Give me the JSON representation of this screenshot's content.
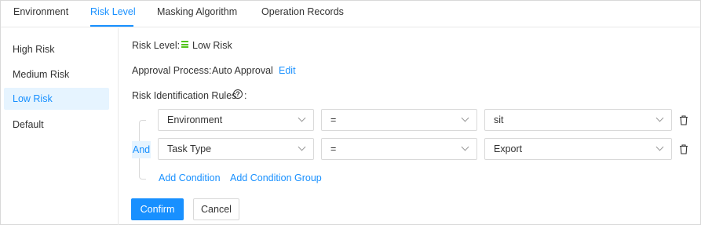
{
  "tabs": [
    {
      "label": "Environment",
      "active": false
    },
    {
      "label": "Risk Level",
      "active": true
    },
    {
      "label": "Masking Algorithm",
      "active": false
    },
    {
      "label": "Operation Records",
      "active": false
    }
  ],
  "sidebar": {
    "items": [
      {
        "label": "High Risk",
        "active": false
      },
      {
        "label": "Medium Risk",
        "active": false
      },
      {
        "label": "Low Risk",
        "active": true
      },
      {
        "label": "Default",
        "active": false
      }
    ]
  },
  "detail": {
    "risk_level_label": "Risk Level:",
    "risk_level_value": "Low Risk",
    "approval_label": "Approval Process:",
    "approval_value": "Auto Approval",
    "edit_label": "Edit",
    "rules_label": "Risk Identification Rules",
    "rules_colon": ":",
    "help_glyph": "?"
  },
  "conditions": {
    "logic": "And",
    "rows": [
      {
        "field": "Environment",
        "operator": "=",
        "value": "sit"
      },
      {
        "field": "Task Type",
        "operator": "=",
        "value": "Export"
      }
    ],
    "add_condition": "Add Condition",
    "add_condition_group": "Add Condition Group"
  },
  "actions": {
    "confirm": "Confirm",
    "cancel": "Cancel"
  },
  "colors": {
    "accent": "#1890ff",
    "low_risk": "#52c41a",
    "active_bg": "#e6f4ff"
  }
}
